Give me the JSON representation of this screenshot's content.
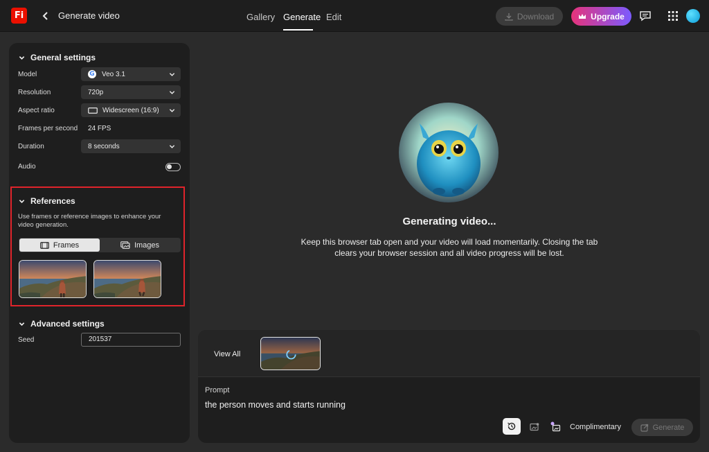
{
  "app": {
    "logo_text": "Fi",
    "page_title": "Generate video"
  },
  "nav": {
    "tabs": [
      {
        "label": "Gallery",
        "active": false
      },
      {
        "label": "Generate",
        "active": true
      },
      {
        "label": "Edit",
        "active": false
      }
    ]
  },
  "header_actions": {
    "download_label": "Download",
    "download_enabled": false,
    "upgrade_label": "Upgrade"
  },
  "general_settings": {
    "title": "General settings",
    "model_label": "Model",
    "model_value": "Veo 3.1",
    "resolution_label": "Resolution",
    "resolution_value": "720p",
    "aspect_label": "Aspect ratio",
    "aspect_value": "Widescreen (16:9)",
    "fps_label": "Frames per second",
    "fps_value": "24 FPS",
    "duration_label": "Duration",
    "duration_value": "8 seconds",
    "audio_label": "Audio",
    "audio_on": false
  },
  "references": {
    "title": "References",
    "description": "Use frames or reference images to enhance your video generation.",
    "frames_label": "Frames",
    "images_label": "Images",
    "active_mode": "Frames"
  },
  "advanced_settings": {
    "title": "Advanced settings",
    "seed_label": "Seed",
    "seed_value": "201537"
  },
  "status": {
    "title": "Generating video...",
    "message": "Keep this browser tab open and your video will load momentarily. Closing the tab clears your browser session and all video progress will be lost."
  },
  "prompt_panel": {
    "view_all_label": "View All",
    "prompt_label": "Prompt",
    "prompt_text": "the person moves and starts running",
    "credit_label": "Complimentary",
    "generate_label": "Generate",
    "generate_enabled": false
  },
  "colors": {
    "accent_red": "#e0242b",
    "upgrade_gradient_start": "#e6337a",
    "upgrade_gradient_end": "#7b5bff",
    "logo_red": "#eb1000"
  }
}
